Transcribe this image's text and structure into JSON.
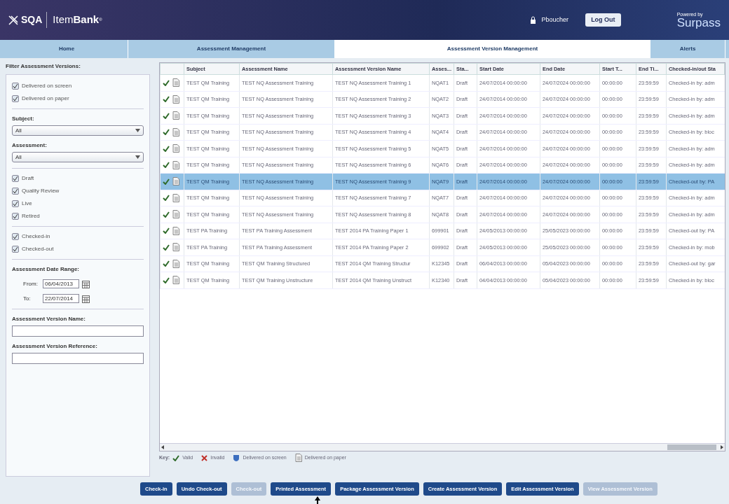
{
  "header": {
    "logo_text": "SQA",
    "product_regular": "Item",
    "product_bold": "Bank",
    "product_mark": "®",
    "user": "Pboucher",
    "logout": "Log Out",
    "powered_by": "Powered by",
    "brand": "Surpass"
  },
  "tabs": [
    {
      "label": "Home",
      "selected": false
    },
    {
      "label": "Assessment Management",
      "selected": false
    },
    {
      "label": "Assessment Version Management",
      "selected": true
    },
    {
      "label": "Alerts",
      "selected": false
    }
  ],
  "filter": {
    "title": "Filter Assessment Versions:",
    "groups": [
      [
        {
          "label": "Delivered on screen",
          "checked": true
        },
        {
          "label": "Delivered on paper",
          "checked": true
        }
      ],
      [
        {
          "label": "Draft",
          "checked": true
        },
        {
          "label": "Quality Review",
          "checked": true
        },
        {
          "label": "Live",
          "checked": true
        },
        {
          "label": "Retired",
          "checked": true
        }
      ],
      [
        {
          "label": "Checked-in",
          "checked": true
        },
        {
          "label": "Checked-out",
          "checked": true
        }
      ]
    ],
    "selects": [
      {
        "label": "Subject:",
        "value": "All"
      },
      {
        "label": "Assessment:",
        "value": "All"
      }
    ],
    "date_range": {
      "label": "Assessment Date Range:",
      "from_label": "From:",
      "from": "06/04/2013",
      "to_label": "To:",
      "to": "22/07/2014"
    },
    "text_fields": [
      {
        "label": "Assessment Version Name:"
      },
      {
        "label": "Assessment Version Reference:"
      }
    ]
  },
  "table": {
    "columns": [
      "Subject",
      "Assessment Name",
      "Assessment Version Name",
      "Asses...",
      "Sta...",
      "Start Date",
      "End Date",
      "Start T...",
      "End Ti...",
      "Checked-in/out Sta"
    ],
    "rows": [
      {
        "valid": true,
        "selected": false,
        "cells": [
          "TEST QM Training",
          "TEST NQ Assessment Training",
          "TEST NQ Assessment Training 1",
          "NQAT1",
          "Draft",
          "24/07/2014 00:00:00",
          "24/07/2024 00:00:00",
          "00:00:00",
          "23:59:59",
          "Checked-in by: adm"
        ]
      },
      {
        "valid": true,
        "selected": false,
        "cells": [
          "TEST QM Training",
          "TEST NQ Assessment Training",
          "TEST NQ Assessment Training 2",
          "NQAT2",
          "Draft",
          "24/07/2014 00:00:00",
          "24/07/2024 00:00:00",
          "00:00:00",
          "23:59:59",
          "Checked-in by: adm"
        ]
      },
      {
        "valid": true,
        "selected": false,
        "cells": [
          "TEST QM Training",
          "TEST NQ Assessment Training",
          "TEST NQ Assessment Training 3",
          "NQAT3",
          "Draft",
          "24/07/2014 00:00:00",
          "24/07/2024 00:00:00",
          "00:00:00",
          "23:59:59",
          "Checked-in by: adm"
        ]
      },
      {
        "valid": true,
        "selected": false,
        "cells": [
          "TEST QM Training",
          "TEST NQ Assessment Training",
          "TEST NQ Assessment Training 4",
          "NQAT4",
          "Draft",
          "24/07/2014 00:00:00",
          "24/07/2024 00:00:00",
          "00:00:00",
          "23:59:59",
          "Checked-in by: bloc"
        ]
      },
      {
        "valid": true,
        "selected": false,
        "cells": [
          "TEST QM Training",
          "TEST NQ Assessment Training",
          "TEST NQ Assessment Training 5",
          "NQAT5",
          "Draft",
          "24/07/2014 00:00:00",
          "24/07/2024 00:00:00",
          "00:00:00",
          "23:59:59",
          "Checked-in by: adm"
        ]
      },
      {
        "valid": true,
        "selected": false,
        "cells": [
          "TEST QM Training",
          "TEST NQ Assessment Training",
          "TEST NQ Assessment Training 6",
          "NQAT6",
          "Draft",
          "24/07/2014 00:00:00",
          "24/07/2024 00:00:00",
          "00:00:00",
          "23:59:59",
          "Checked-in by: adm"
        ]
      },
      {
        "valid": true,
        "selected": true,
        "cells": [
          "TEST QM Training",
          "TEST NQ Assessment Training",
          "TEST NQ Assessment Training 9",
          "NQAT9",
          "Draft",
          "24/07/2014 00:00:00",
          "24/07/2024 00:00:00",
          "00:00:00",
          "23:59:59",
          "Checked-out by: PA"
        ]
      },
      {
        "valid": true,
        "selected": false,
        "cells": [
          "TEST QM Training",
          "TEST NQ Assessment Training",
          "TEST NQ Assessment Training 7",
          "NQAT7",
          "Draft",
          "24/07/2014 00:00:00",
          "24/07/2024 00:00:00",
          "00:00:00",
          "23:59:59",
          "Checked-in by: adm"
        ]
      },
      {
        "valid": true,
        "selected": false,
        "cells": [
          "TEST QM Training",
          "TEST NQ Assessment Training",
          "TEST NQ Assessment Training 8",
          "NQAT8",
          "Draft",
          "24/07/2014 00:00:00",
          "24/07/2024 00:00:00",
          "00:00:00",
          "23:59:59",
          "Checked-in by: adm"
        ]
      },
      {
        "valid": true,
        "selected": false,
        "cells": [
          "TEST PA Training",
          "TEST PA Training Assessment",
          "TEST 2014 PA Training Paper 1",
          "699901",
          "Draft",
          "24/05/2013 00:00:00",
          "25/05/2023 00:00:00",
          "00:00:00",
          "23:59:59",
          "Checked-out by: PA"
        ]
      },
      {
        "valid": true,
        "selected": false,
        "cells": [
          "TEST PA Training",
          "TEST PA Training Assessment",
          "TEST 2014 PA Training Paper 2",
          "699902",
          "Draft",
          "24/05/2013 00:00:00",
          "25/05/2023 00:00:00",
          "00:00:00",
          "23:59:59",
          "Checked-in by: mob"
        ]
      },
      {
        "valid": true,
        "selected": false,
        "cells": [
          "TEST QM Training",
          "TEST QM Training Structured",
          "TEST 2014 QM Training Structur",
          "K12345",
          "Draft",
          "06/04/2013 00:00:00",
          "05/04/2023 00:00:00",
          "00:00:00",
          "23:59:59",
          "Checked-out by: gar"
        ]
      },
      {
        "valid": true,
        "selected": false,
        "cells": [
          "TEST QM Training",
          "TEST QM Training Unstructure",
          "TEST 2014 QM Training Unstruct",
          "K12340",
          "Draft",
          "04/04/2013 00:00:00",
          "05/04/2023 00:00:00",
          "00:00:00",
          "23:59:59",
          "Checked-in by: bloc"
        ]
      }
    ]
  },
  "key": {
    "label": "Key:",
    "items": [
      {
        "kind": "valid",
        "label": "Valid"
      },
      {
        "kind": "invalid",
        "label": "Invalid"
      },
      {
        "kind": "screen",
        "label": "Delivered on screen"
      },
      {
        "kind": "paper",
        "label": "Delivered on paper"
      }
    ]
  },
  "buttons": [
    {
      "label": "Check-in",
      "disabled": false
    },
    {
      "label": "Undo Check-out",
      "disabled": false
    },
    {
      "label": "Check-out",
      "disabled": true
    },
    {
      "label": "Printed Assessment",
      "disabled": false
    },
    {
      "label": "Package Assessment Version",
      "disabled": false
    },
    {
      "label": "Create Assessment Version",
      "disabled": false
    },
    {
      "label": "Edit Assessment Version",
      "disabled": false
    },
    {
      "label": "View Assessment Version",
      "disabled": true
    }
  ]
}
